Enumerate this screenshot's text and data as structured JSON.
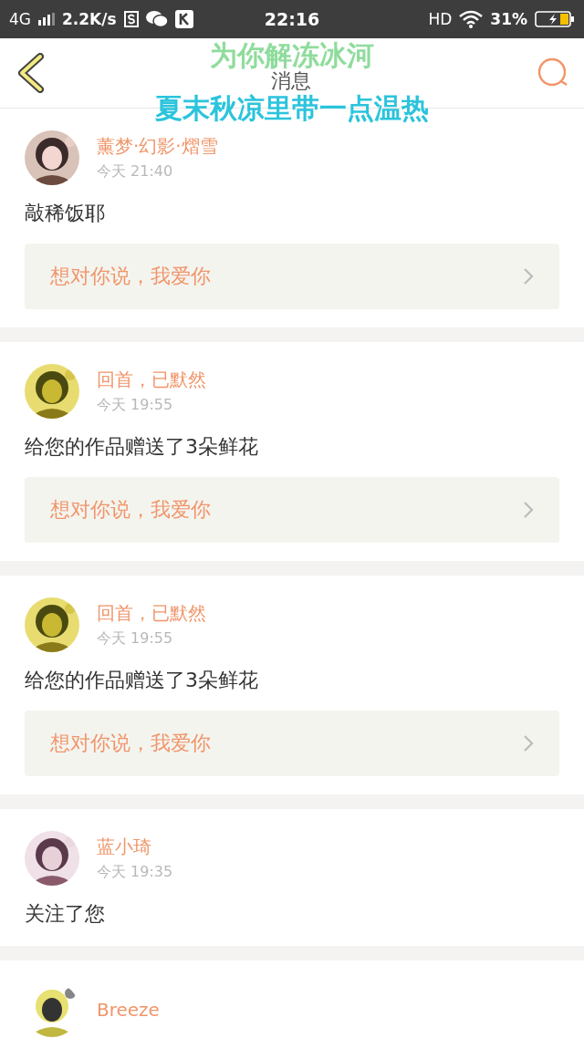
{
  "status_bar": {
    "network": "4G",
    "speed": "2.2K/s",
    "time": "22:16",
    "hd": "HD",
    "battery": "31%"
  },
  "header": {
    "title": "消息"
  },
  "lyrics_overlay": {
    "lines": [
      "为你解冻冰河",
      "夏末秋凉里带一点温热"
    ]
  },
  "messages": [
    {
      "name": "薰梦·幻影·熠雪",
      "time": "今天 21:40",
      "text": "敲稀饭耶",
      "reply": "想对你说，我爱你"
    },
    {
      "name": "回首，已默然",
      "time": "今天 19:55",
      "text": "给您的作品赠送了3朵鲜花",
      "reply": "想对你说，我爱你"
    },
    {
      "name": "回首，已默然",
      "time": "今天 19:55",
      "text": "给您的作品赠送了3朵鲜花",
      "reply": "想对你说，我爱你"
    },
    {
      "name": "蓝小琦",
      "time": "今天 19:35",
      "text": "关注了您"
    },
    {
      "name": "Breeze"
    }
  ]
}
